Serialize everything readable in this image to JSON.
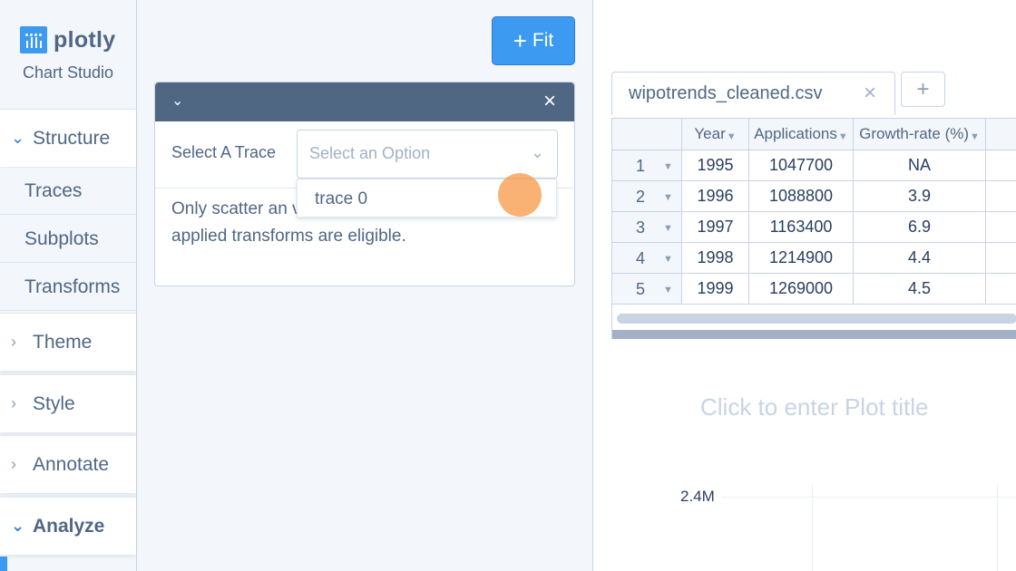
{
  "app": {
    "logo_text": "plotly",
    "subtitle": "Chart Studio"
  },
  "sidebar": {
    "sections": [
      {
        "label": "Structure",
        "open": true,
        "icon": "chevron-down-icon"
      },
      {
        "label": "Theme",
        "open": false,
        "icon": "chevron-right-icon"
      },
      {
        "label": "Style",
        "open": false,
        "icon": "chevron-right-icon"
      },
      {
        "label": "Annotate",
        "open": false,
        "icon": "chevron-right-icon"
      },
      {
        "label": "Analyze",
        "open": true,
        "icon": "chevron-down-icon"
      }
    ],
    "structure_items": [
      "Traces",
      "Subplots",
      "Transforms"
    ]
  },
  "panel": {
    "fit_label": "Fit",
    "select_trace_label": "Select A Trace",
    "select_placeholder": "Select an Option",
    "dropdown_option": "trace 0",
    "info_text": "Only scatter an values selected and with no applied transforms are eligible."
  },
  "grid": {
    "tab_name": "wipotrends_cleaned.csv",
    "add_label": "+",
    "columns": [
      "Year",
      "Applications",
      "Growth-rate (%)"
    ],
    "rows": [
      {
        "num": "1",
        "year": "1995",
        "applications": "1047700",
        "growth": "NA"
      },
      {
        "num": "2",
        "year": "1996",
        "applications": "1088800",
        "growth": "3.9"
      },
      {
        "num": "3",
        "year": "1997",
        "applications": "1163400",
        "growth": "6.9"
      },
      {
        "num": "4",
        "year": "1998",
        "applications": "1214900",
        "growth": "4.4"
      },
      {
        "num": "5",
        "year": "1999",
        "applications": "1269000",
        "growth": "4.5"
      }
    ]
  },
  "plot": {
    "title_placeholder": "Click to enter Plot title",
    "y_tick": "2.4M"
  },
  "colors": {
    "accent": "#3c9af0",
    "header_bar": "#506784",
    "cursor": "#f79846"
  }
}
